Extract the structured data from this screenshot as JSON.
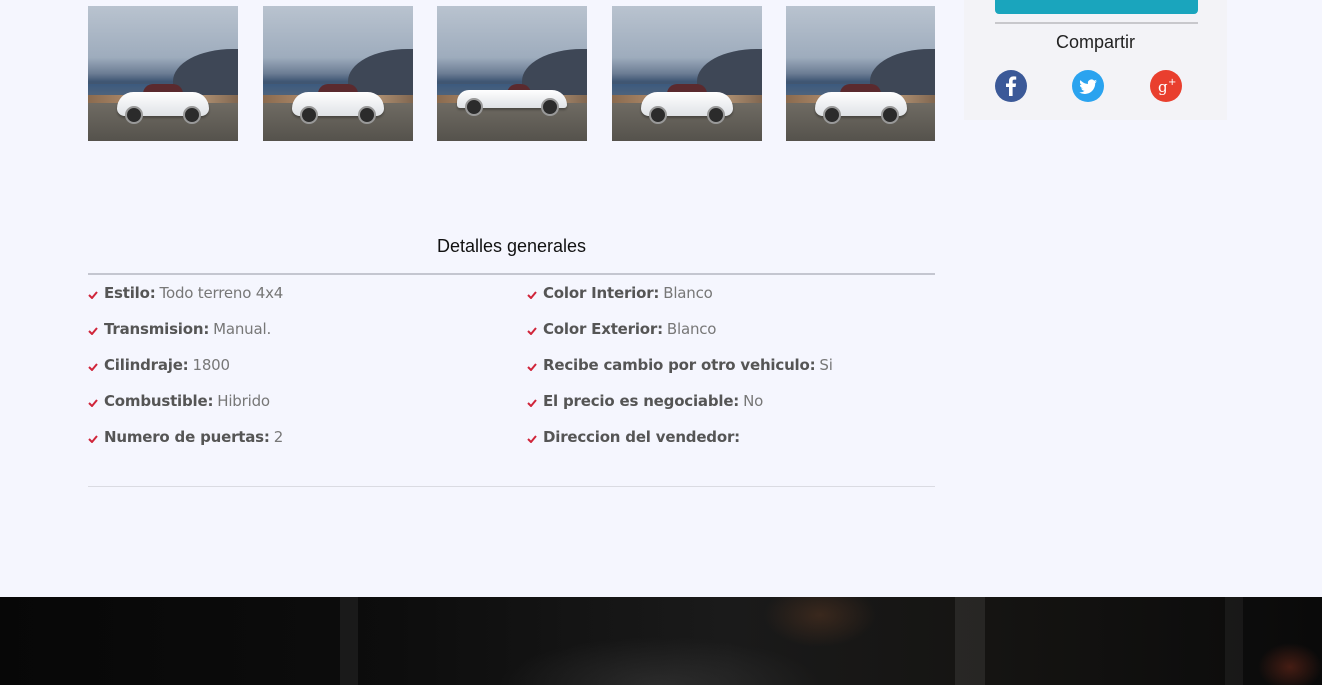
{
  "gallery": {
    "thumbnails": [
      {
        "icon": "car-rear-photo"
      },
      {
        "icon": "car-front-photo"
      },
      {
        "icon": "car-side-photo"
      },
      {
        "icon": "car-rear-photo"
      },
      {
        "icon": "car-front-photo"
      }
    ]
  },
  "sidebar": {
    "share_title": "Compartir",
    "social": [
      {
        "name": "facebook",
        "color": "#3b5998"
      },
      {
        "name": "twitter",
        "color": "#2aa3ef"
      },
      {
        "name": "google-plus",
        "color": "#e93f2e"
      }
    ],
    "accent_color": "#1aa5bd"
  },
  "details": {
    "title": "Detalles generales",
    "check_color": "#d0253a",
    "left": [
      {
        "label": "Estilo:",
        "value": "Todo terreno 4x4"
      },
      {
        "label": "Transmision:",
        "value": "Manual."
      },
      {
        "label": "Cilindraje:",
        "value": "1800"
      },
      {
        "label": "Combustible:",
        "value": "Hibrido"
      },
      {
        "label": "Numero de puertas:",
        "value": "2"
      }
    ],
    "right": [
      {
        "label": "Color Interior:",
        "value": "Blanco"
      },
      {
        "label": "Color Exterior:",
        "value": "Blanco"
      },
      {
        "label": "Recibe cambio por otro vehiculo:",
        "value": "Si"
      },
      {
        "label": "El precio es negociable:",
        "value": "No"
      },
      {
        "label": "Direccion del vendedor:",
        "value": ""
      }
    ]
  }
}
